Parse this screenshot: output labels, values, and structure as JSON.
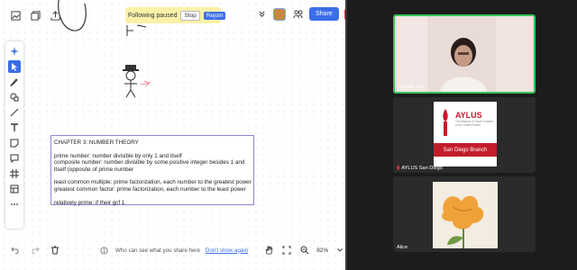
{
  "banner": {
    "text": "Following paused",
    "stop_label": "Stop",
    "rejoin_label": "Rejoin"
  },
  "header": {
    "share_label": "Share",
    "close_symbol": "✕"
  },
  "tools": [
    "sparkle-icon",
    "select-icon",
    "pen-icon",
    "shapes-icon",
    "line-icon",
    "text-icon",
    "sticky-note-icon",
    "comment-icon",
    "frame-icon",
    "table-icon",
    "more-icon"
  ],
  "textbox": {
    "lines": [
      "CHAPTER 3: NUMBER THEORY",
      "",
      "prime number: number divisible by only 1 and itself",
      "composite number: number divisible by some positive integer besides 1 and",
      "itself (opposite of prime number",
      "",
      "least common multiple: prime factorization, each number to the greatest power",
      "greatest common factor: prime factorization, each number to the least power",
      "",
      "relatively prime: if their gcf 1"
    ]
  },
  "bottom": {
    "privacy_text": "Who can see what you share here",
    "dont_show_label": "Don't show again",
    "zoom_label": "82%"
  },
  "participants": [
    {
      "name": "Angela Xue",
      "muted": false
    },
    {
      "name": "AYLUS San Diego",
      "muted": true
    },
    {
      "name": "Alice",
      "muted": false
    }
  ],
  "aylus": {
    "title": "AYLUS",
    "subtitle": "The Alliance of Youth Leaders in the United States",
    "branch": "San Diego Branch"
  },
  "colors": {
    "accent": "#3b6ee8",
    "active_speaker": "#37c35a",
    "banner_bg": "#fbf1a8",
    "danger": "#e0364b",
    "aylus_red": "#c21d2b"
  }
}
